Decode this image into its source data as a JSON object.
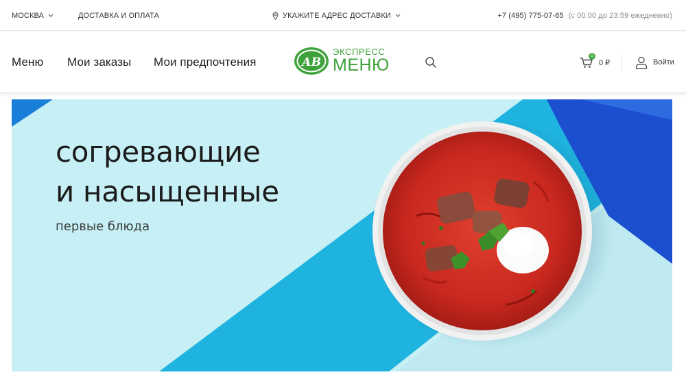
{
  "topbar": {
    "city": "МОСКВА",
    "delivery_link": "ДОСТАВКА И ОПЛАТА",
    "address_prompt": "УКАЖИТЕ АДРЕС ДОСТАВКИ",
    "phone": "+7 (495) 775-07-65",
    "hours": "(с 00:00 до 23:59 ежедневно)"
  },
  "header": {
    "nav": [
      "Меню",
      "Мои заказы",
      "Мои предпочтения"
    ],
    "logo": {
      "line1": "ЭКСПРЕСС",
      "line2": "МЕНЮ",
      "emblem": "АВ"
    },
    "cart": {
      "count": "0",
      "total": "0 ₽"
    },
    "login_label": "Войти"
  },
  "hero": {
    "title_line1": "согревающие",
    "title_line2": "и насыщенные",
    "subtitle": "первые блюда"
  },
  "colors": {
    "brand_green": "#3ea23a",
    "hero_light": "#c6f0f5",
    "hero_cyan": "#1fb3df",
    "hero_blue": "#1b4fd0",
    "soup_red": "#c8281f"
  },
  "icons": [
    "chevron-down-icon",
    "location-pin-icon",
    "search-icon",
    "cart-icon",
    "user-icon"
  ]
}
